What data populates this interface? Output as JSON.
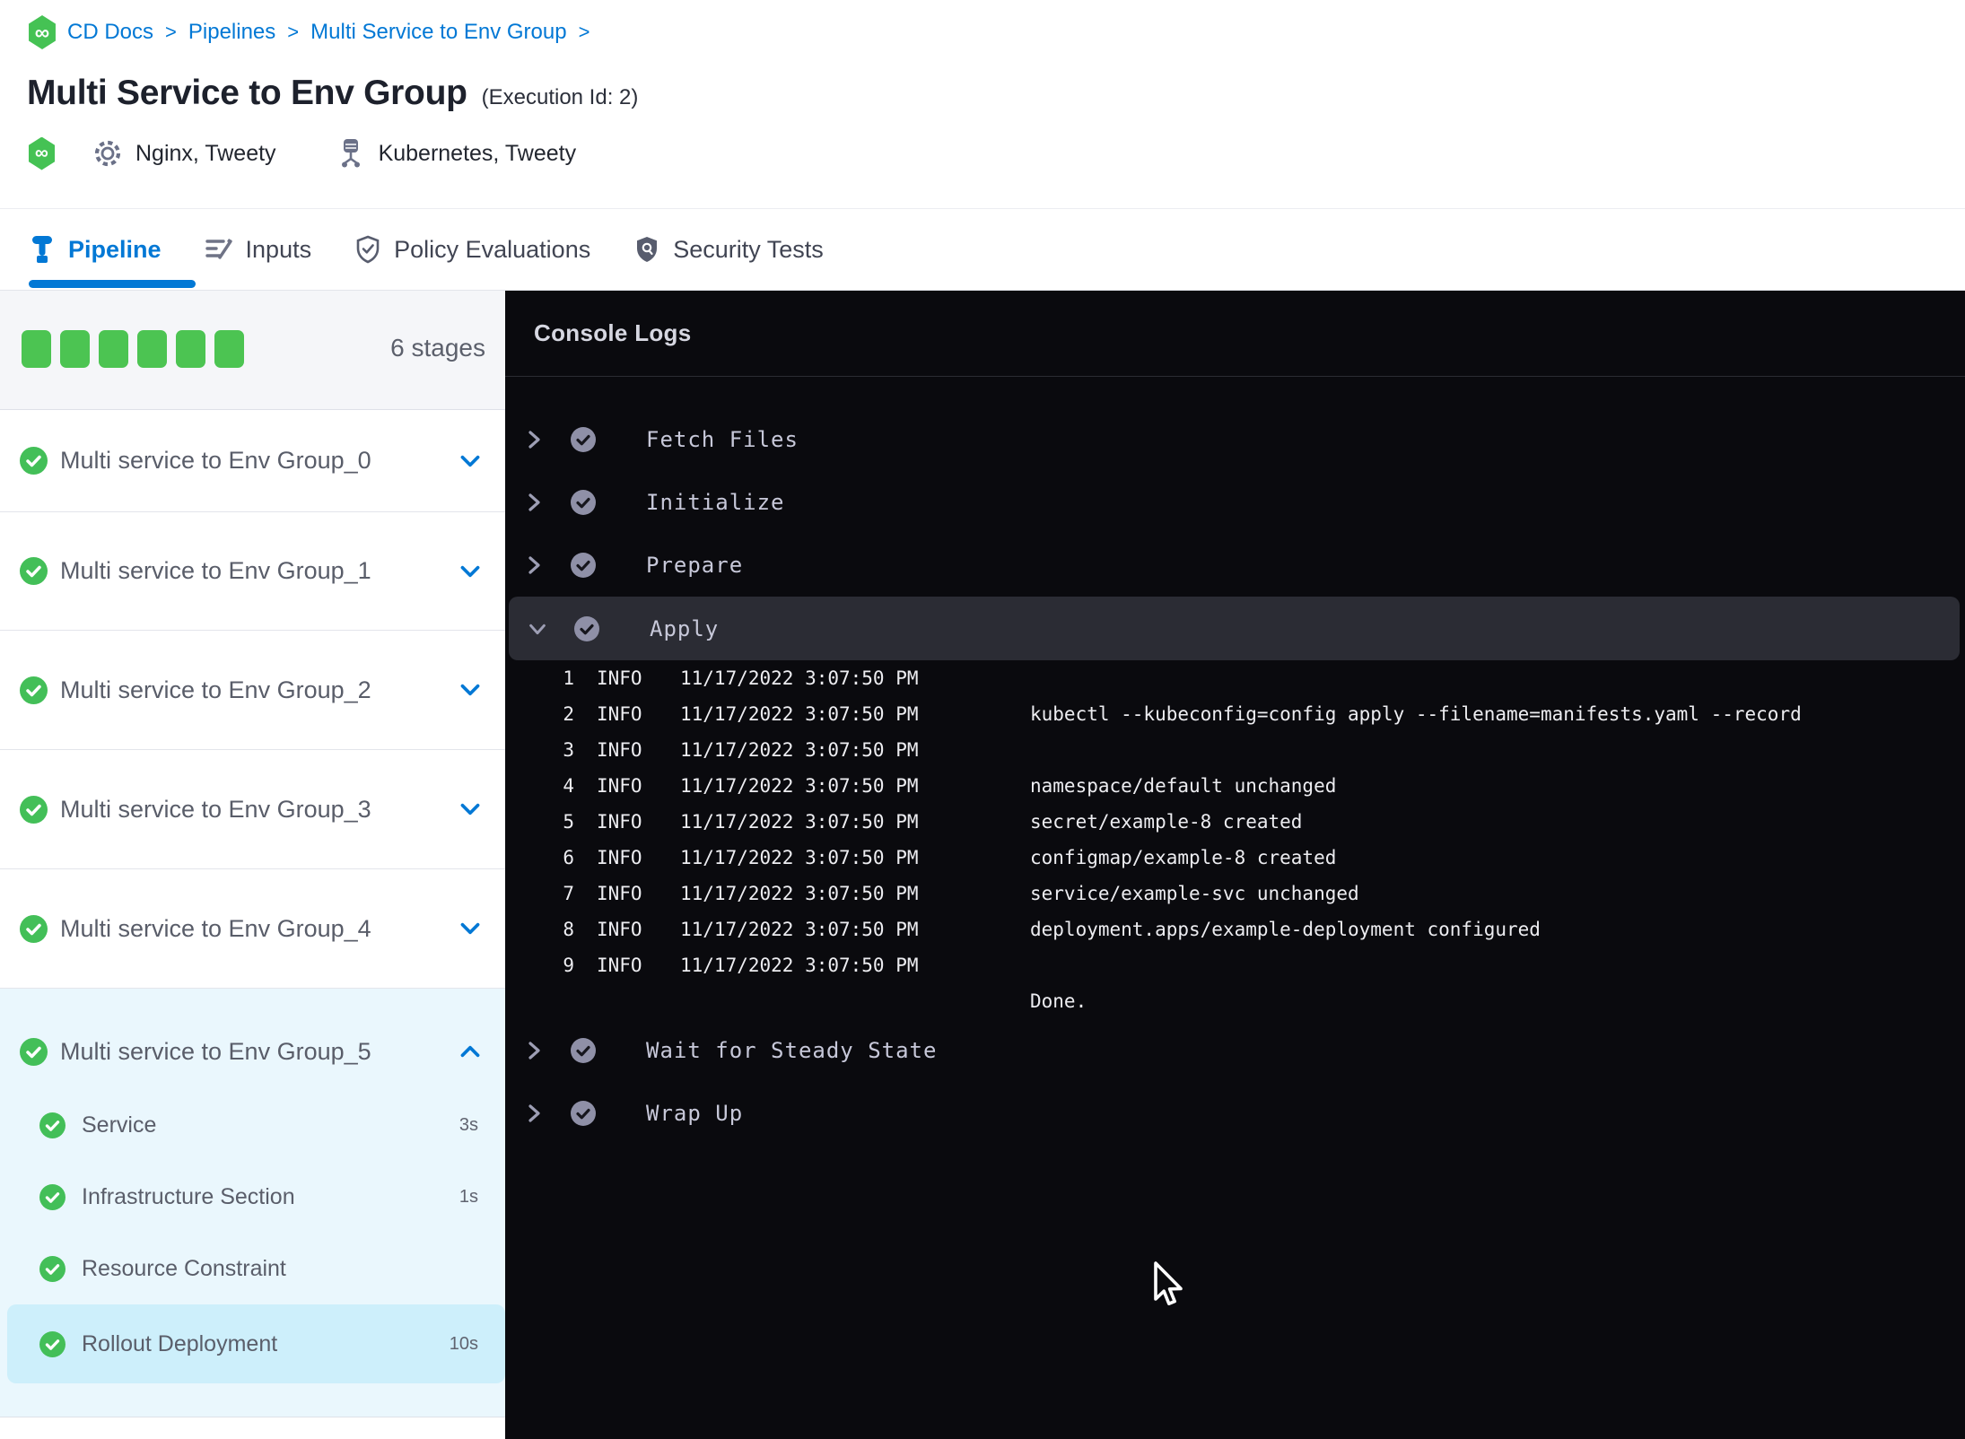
{
  "colors": {
    "accent_blue": "#0278d5",
    "success_green": "#45c254",
    "console_bg": "#0a0a0e",
    "selected_step_bg": "#cdeffb",
    "expanded_stage_bg": "#eaf7fd"
  },
  "breadcrumb": {
    "items": [
      "CD Docs",
      "Pipelines",
      "Multi Service to Env Group"
    ],
    "separator": ">",
    "logo_glyph": "∞"
  },
  "header": {
    "title": "Multi Service to Env Group",
    "execution_id": "(Execution Id: 2)",
    "services": [
      {
        "icon": "gear-icon",
        "label": "Nginx, Tweety"
      },
      {
        "icon": "environment-icon",
        "label": "Kubernetes, Tweety"
      }
    ]
  },
  "tabs": [
    {
      "label": "Pipeline",
      "icon": "pipeline-icon",
      "active": true
    },
    {
      "label": "Inputs",
      "icon": "inputs-icon",
      "active": false
    },
    {
      "label": "Policy Evaluations",
      "icon": "shield-check-icon",
      "active": false
    },
    {
      "label": "Security Tests",
      "icon": "shield-search-icon",
      "active": false
    }
  ],
  "sidebar": {
    "progress_squares": 6,
    "stage_count_label": "6 stages",
    "stages": [
      {
        "label": "Multi service to Env Group_0",
        "status": "success",
        "expanded": false
      },
      {
        "label": "Multi service to Env Group_1",
        "status": "success",
        "expanded": false
      },
      {
        "label": "Multi service to Env Group_2",
        "status": "success",
        "expanded": false
      },
      {
        "label": "Multi service to Env Group_3",
        "status": "success",
        "expanded": false
      },
      {
        "label": "Multi service to Env Group_4",
        "status": "success",
        "expanded": false
      }
    ],
    "expanded_stage": {
      "label": "Multi service to Env Group_5",
      "status": "success",
      "steps": [
        {
          "label": "Service",
          "duration": "3s",
          "status": "success",
          "selected": false
        },
        {
          "label": "Infrastructure Section",
          "duration": "1s",
          "status": "success",
          "selected": false
        },
        {
          "label": "Resource Constraint",
          "duration": "",
          "status": "success",
          "selected": false
        },
        {
          "label": "Rollout Deployment",
          "duration": "10s",
          "status": "success",
          "selected": true
        }
      ]
    }
  },
  "console": {
    "title": "Console Logs",
    "sections": [
      {
        "label": "Fetch Files",
        "expanded": false
      },
      {
        "label": "Initialize",
        "expanded": false
      },
      {
        "label": "Prepare",
        "expanded": false
      },
      {
        "label": "Apply",
        "expanded": true,
        "logs": [
          {
            "n": "1",
            "level": "INFO",
            "time": "11/17/2022 3:07:50 PM",
            "msg": ""
          },
          {
            "n": "2",
            "level": "INFO",
            "time": "11/17/2022 3:07:50 PM",
            "msg": "kubectl --kubeconfig=config apply --filename=manifests.yaml --record"
          },
          {
            "n": "3",
            "level": "INFO",
            "time": "11/17/2022 3:07:50 PM",
            "msg": ""
          },
          {
            "n": "4",
            "level": "INFO",
            "time": "11/17/2022 3:07:50 PM",
            "msg": "namespace/default unchanged"
          },
          {
            "n": "5",
            "level": "INFO",
            "time": "11/17/2022 3:07:50 PM",
            "msg": "secret/example-8 created"
          },
          {
            "n": "6",
            "level": "INFO",
            "time": "11/17/2022 3:07:50 PM",
            "msg": "configmap/example-8 created"
          },
          {
            "n": "7",
            "level": "INFO",
            "time": "11/17/2022 3:07:50 PM",
            "msg": "service/example-svc unchanged"
          },
          {
            "n": "8",
            "level": "INFO",
            "time": "11/17/2022 3:07:50 PM",
            "msg": "deployment.apps/example-deployment configured"
          },
          {
            "n": "9",
            "level": "INFO",
            "time": "11/17/2022 3:07:50 PM",
            "msg": ""
          }
        ],
        "footer": "Done."
      },
      {
        "label": "Wait for Steady State",
        "expanded": false
      },
      {
        "label": "Wrap Up",
        "expanded": false
      }
    ]
  }
}
